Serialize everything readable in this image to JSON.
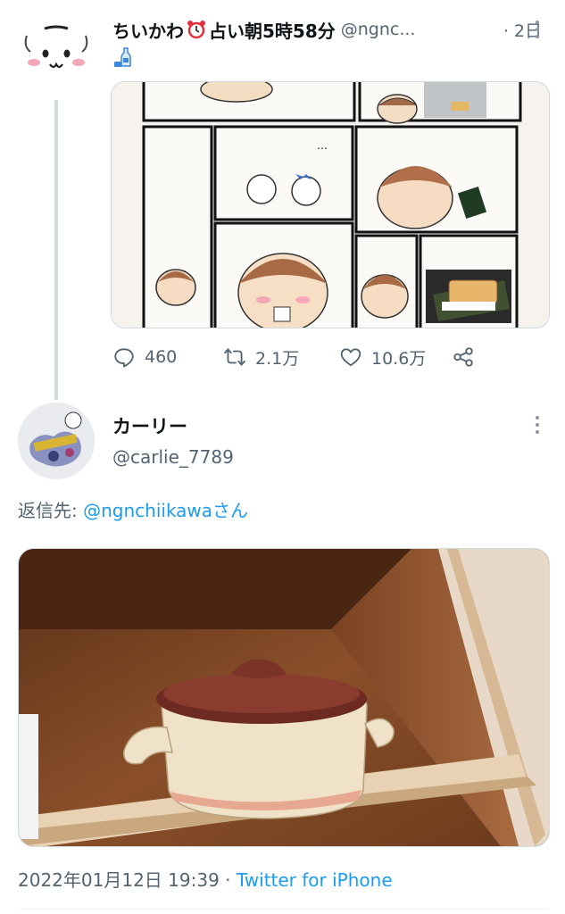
{
  "original_tweet": {
    "display_name": "ちいかわ",
    "name_suffix": "占い朝5時58分",
    "handle": "@ngnc...",
    "time": "· 2日",
    "second_line_emoji": "sake-bottle-emoji",
    "media_description": "manga-panel-image",
    "actions": {
      "reply_count": "460",
      "retweet_count": "2.1万",
      "like_count": "10.6万"
    }
  },
  "reply_tweet": {
    "display_name": "カーリー",
    "handle": "@carlie_7789",
    "reply_to_prefix": "返信先: ",
    "reply_to_mention": "@ngnchiikawaさん",
    "timestamp": "2022年01月12日 19:39",
    "separator": " · ",
    "client": "Twitter for iPhone"
  },
  "colors": {
    "link": "#1d9bf0",
    "secondary_text": "#536471",
    "thread_line": "#cfd9de"
  }
}
